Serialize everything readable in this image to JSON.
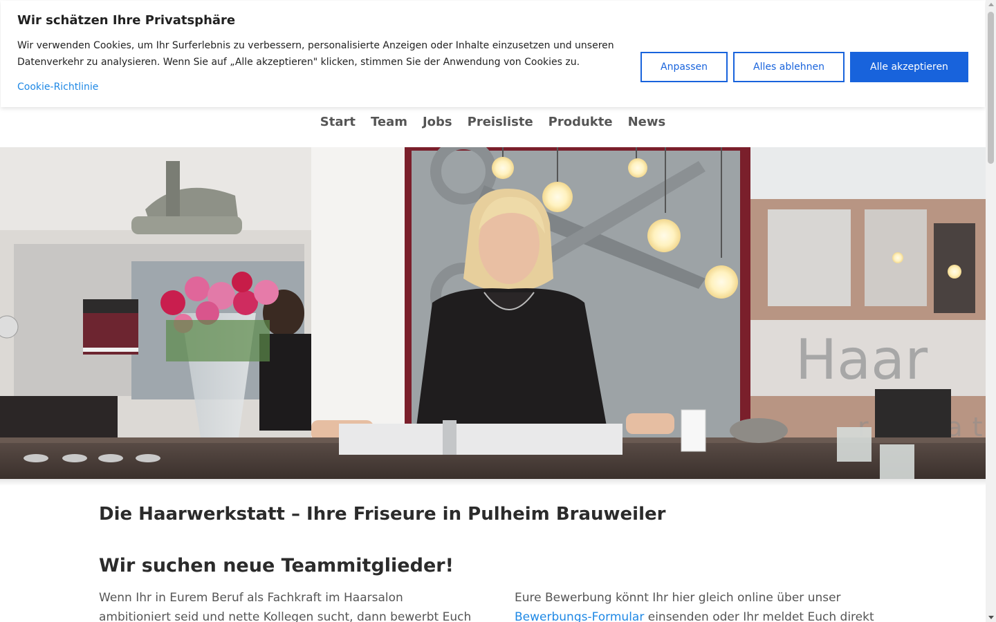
{
  "cookie_banner": {
    "title": "Wir schätzen Ihre Privatsphäre",
    "text": "Wir verwenden Cookies, um Ihr Surferlebnis zu verbessern, personalisierte Anzeigen oder Inhalte einzusetzen und unseren Datenverkehr zu analysieren. Wenn Sie auf „Alle akzeptieren\" klicken, stimmen Sie der Anwendung von Cookies zu.",
    "policy_link": "Cookie-Richtlinie",
    "customize_label": "Anpassen",
    "reject_label": "Alles ablehnen",
    "accept_label": "Alle akzeptieren"
  },
  "nav": {
    "items": [
      "Start",
      "Team",
      "Jobs",
      "Preisliste",
      "Produkte",
      "News"
    ]
  },
  "hero": {
    "logo_text": "Haar",
    "logo_subtext": "rkstatt"
  },
  "main": {
    "title": "Die Haarwerkstatt – Ihre Friseure in Pulheim Brauweiler",
    "subtitle": "Wir suchen neue Teammitglieder!",
    "left_text": "Wenn Ihr in Eurem Beruf als Fachkraft im Haarsalon ambitioniert seid und nette Kollegen sucht, dann bewerbt Euch",
    "right_text_before": "Eure Bewerbung könnt Ihr hier gleich online über unser",
    "right_link": "Bewerbungs-Formular",
    "right_text_after": " einsenden oder Ihr meldet Euch direkt"
  },
  "colors": {
    "accent": "#1863dc",
    "link": "#1e88e5",
    "wall_red": "#7a1f2b"
  }
}
